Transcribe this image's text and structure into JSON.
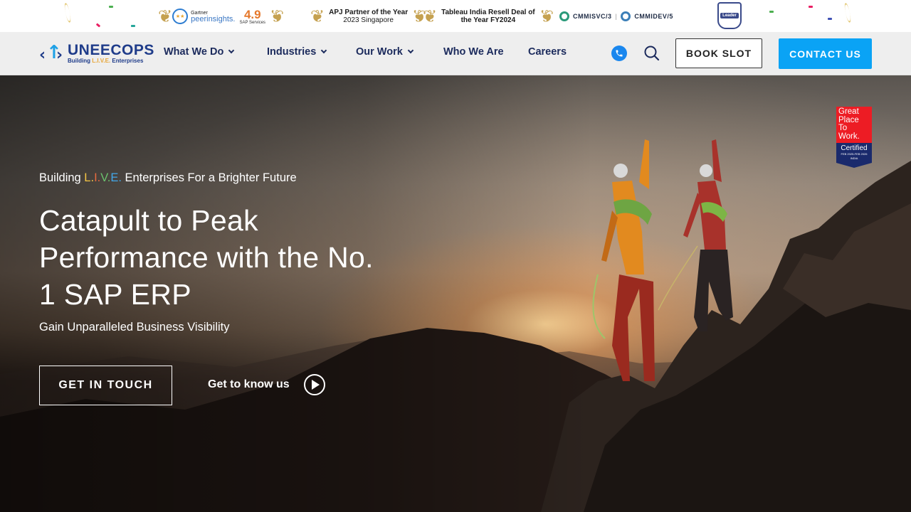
{
  "awards": {
    "gartner_brand": "Gartner",
    "gartner_product": "peerinsights.",
    "gartner_score": "4.9",
    "gartner_score_label": "SAP Services",
    "apj_title": "APJ Partner of the Year",
    "apj_sub": "2023 Singapore",
    "tableau_title": "Tableau India Resell Deal of",
    "tableau_sub": "the Year FY2024",
    "cmmi_svc": "CMMISVC/3",
    "cmmi_dev": "CMMIDEV/5",
    "leader_badge": "Leader"
  },
  "nav": {
    "logo_name": "UNEECOPS",
    "logo_tag_before": "Building ",
    "logo_tag_live": "L.I.V.E.",
    "logo_tag_after": " Enterprises",
    "items": [
      {
        "label": "What We Do",
        "has_dropdown": true
      },
      {
        "label": "Industries",
        "has_dropdown": true
      },
      {
        "label": "Our Work",
        "has_dropdown": true
      },
      {
        "label": "Who We Are",
        "has_dropdown": false
      },
      {
        "label": "Careers",
        "has_dropdown": false
      }
    ],
    "icons": {
      "phone": "phone-icon",
      "search": "search-icon"
    },
    "book_slot": "BOOK SLOT",
    "contact_us": "CONTACT US",
    "accent_color": "#0aa3f5"
  },
  "hero": {
    "badge": {
      "lines": [
        "Great",
        "Place",
        "To",
        "Work."
      ],
      "certified": "Certified",
      "dates": "FEB 2025-FEB 2026",
      "country": "INDIA"
    },
    "eyebrow_before": "Building ",
    "eyebrow_live": [
      "L.",
      "I.",
      "V.",
      "E."
    ],
    "eyebrow_after": " Enterprises For a Brighter Future",
    "headline": "Catapult to Peak Performance with the No. 1 SAP ERP",
    "subhead": "Gain Unparalleled Business Visibility",
    "cta_primary": "GET IN TOUCH",
    "cta_secondary": "Get to know us"
  }
}
